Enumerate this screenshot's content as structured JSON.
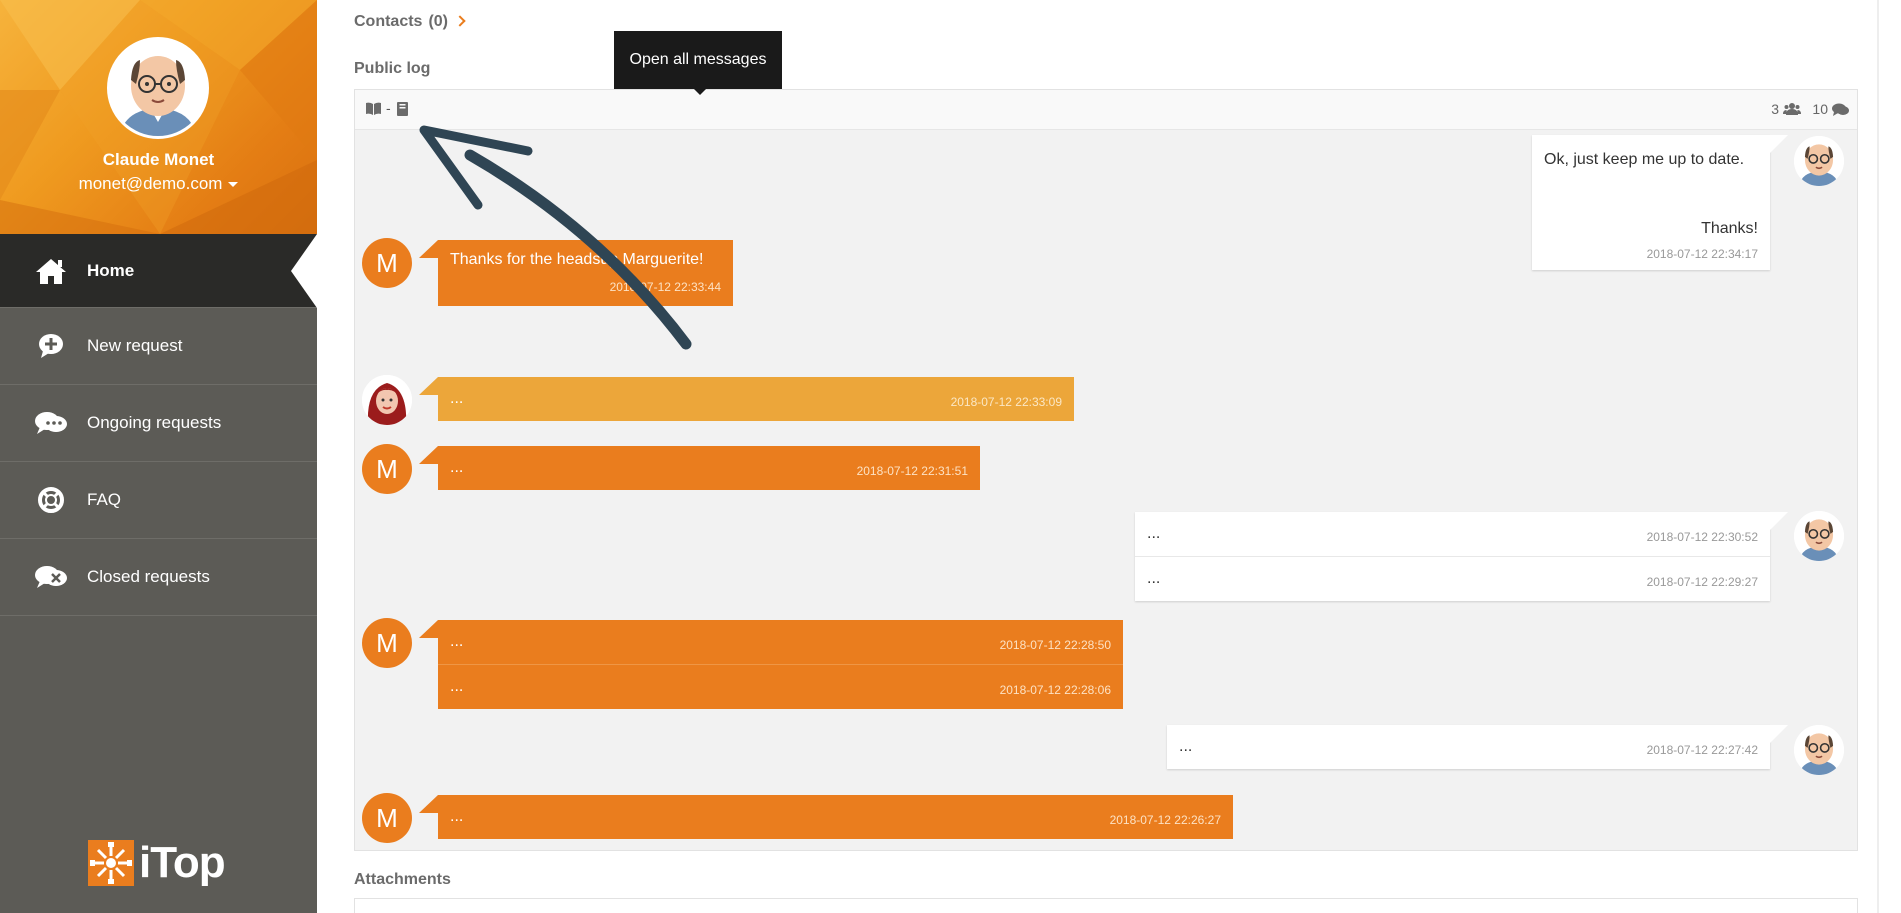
{
  "sidebar": {
    "user": {
      "name": "Claude Monet",
      "email": "monet@demo.com"
    },
    "menu": [
      {
        "label": "Home",
        "icon": "home-icon",
        "active": true
      },
      {
        "label": "New request",
        "icon": "new-request-icon",
        "active": false
      },
      {
        "label": "Ongoing requests",
        "icon": "ongoing-requests-icon",
        "active": false
      },
      {
        "label": "FAQ",
        "icon": "lifebuoy-icon",
        "active": false
      },
      {
        "label": "Closed requests",
        "icon": "closed-requests-icon",
        "active": false
      }
    ],
    "logo_text": "iTop"
  },
  "main": {
    "contacts": {
      "label": "Contacts",
      "count": "(0)"
    },
    "public_log": {
      "label": "Public log",
      "tooltip": "Open all messages",
      "toolbar": {
        "separator": "-",
        "participants": "3",
        "messages": "10"
      },
      "messages": [
        {
          "author": "self",
          "lines": [
            {
              "text": "Ok, just keep me up to date.",
              "text2": "Thanks!",
              "time": "2018-07-12 22:34:17"
            }
          ]
        },
        {
          "author": "M",
          "lines": [
            {
              "text": "Thanks for the headsup Marguerite!",
              "time": "2018-07-12 22:33:44"
            }
          ]
        },
        {
          "author": "woman",
          "lines": [
            {
              "text": "...",
              "time": "2018-07-12 22:33:09"
            }
          ]
        },
        {
          "author": "M",
          "lines": [
            {
              "text": "...",
              "time": "2018-07-12 22:31:51"
            }
          ]
        },
        {
          "author": "self",
          "lines": [
            {
              "text": "...",
              "time": "2018-07-12 22:30:52"
            },
            {
              "text": "...",
              "time": "2018-07-12 22:29:27"
            }
          ]
        },
        {
          "author": "M",
          "lines": [
            {
              "text": "...",
              "time": "2018-07-12 22:28:50"
            },
            {
              "text": "...",
              "time": "2018-07-12 22:28:06"
            }
          ]
        },
        {
          "author": "self",
          "lines": [
            {
              "text": "...",
              "time": "2018-07-12 22:27:42"
            }
          ]
        },
        {
          "author": "M",
          "lines": [
            {
              "text": "...",
              "time": "2018-07-12 22:26:27"
            }
          ]
        }
      ]
    },
    "attachments": {
      "label": "Attachments"
    }
  },
  "colors": {
    "accent": "#ea7d1e",
    "accent_light": "#eca63a",
    "sidebar_bg": "#5c5b56",
    "sidebar_active": "#2a2a28"
  },
  "avatar_letter": "M"
}
